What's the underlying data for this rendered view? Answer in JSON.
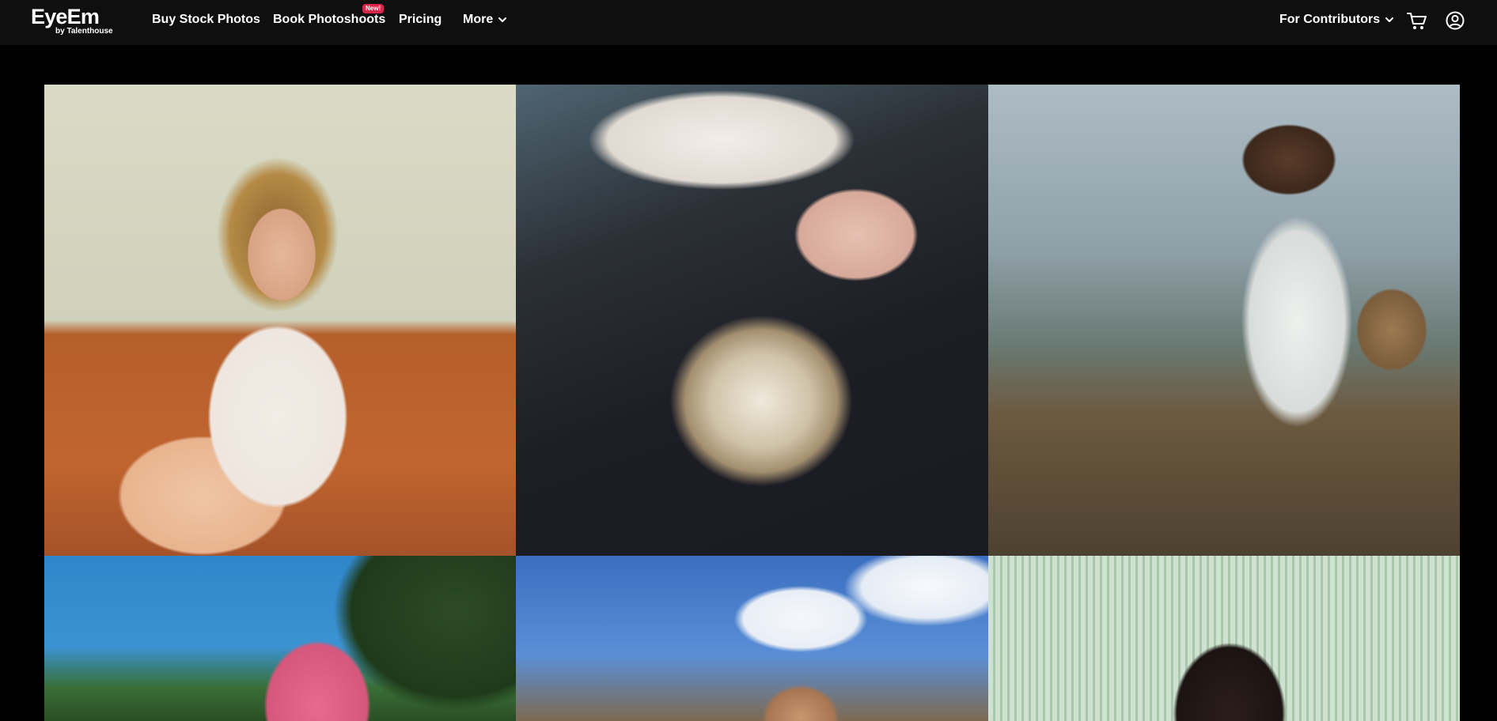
{
  "header": {
    "logo": {
      "name": "EyeEm",
      "tagline": "by Talenthouse"
    },
    "nav": [
      {
        "label": "Buy Stock Photos"
      },
      {
        "label": "Book Photoshoots",
        "badge": "New!"
      },
      {
        "label": "Pricing"
      },
      {
        "label": "More"
      }
    ],
    "contributors_label": "For Contributors",
    "icons": {
      "cart": "cart-icon",
      "account": "user-circle-icon",
      "chevron": "chevron-down-icon"
    }
  },
  "colors": {
    "header_bg": "#0f0f10",
    "page_bg": "#000000",
    "badge": "#e0234b"
  },
  "gallery": {
    "photos": [
      {
        "subject": "woman-sitting-on-orange-couch"
      },
      {
        "subject": "couple-embrace-with-bouquet"
      },
      {
        "subject": "man-carrying-rope-in-field"
      },
      {
        "subject": "woman-pink-hair-green-sunglasses"
      },
      {
        "subject": "woman-in-wildflowers-sky"
      },
      {
        "subject": "woman-striped-green-background"
      }
    ]
  }
}
